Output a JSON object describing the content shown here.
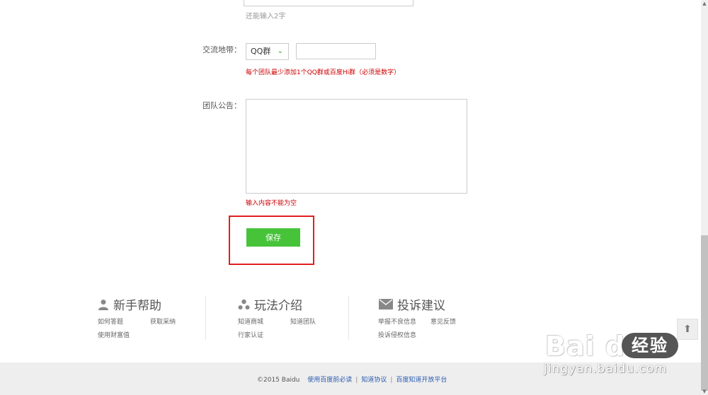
{
  "form": {
    "name_char_hint": "还能输入2字",
    "contact_label": "交流地带：",
    "contact_select_value": "QQ群",
    "contact_input_value": "",
    "contact_error": "每个团队最少添加1个QQ群或百度Hi群（必须是数字）",
    "notice_label": "团队公告：",
    "notice_value": "",
    "notice_error": "输入内容不能为空",
    "save_label": "保存"
  },
  "footer": {
    "columns": [
      {
        "title": "新手帮助",
        "icon": "user-icon",
        "links": [
          "如何答题",
          "获取采纳",
          "使用财富值"
        ]
      },
      {
        "title": "玩法介绍",
        "icon": "molecule-icon",
        "links": [
          "知道商城",
          "知道团队",
          "行家认证"
        ]
      },
      {
        "title": "投诉建议",
        "icon": "mail-icon",
        "links": [
          "举报不良信息",
          "意见反馈",
          "投诉侵权信息"
        ]
      }
    ],
    "copyright": "©2015 Baidu",
    "bottom_links": [
      "使用百度前必读",
      "知道协议",
      "百度知道开放平台"
    ]
  },
  "watermark": {
    "brand": "Bai du",
    "badge": "经验",
    "url": "jingyan.baidu.com"
  },
  "colors": {
    "accent_green": "#47c33a",
    "error_red": "#cc0000",
    "highlight_red": "#e02020",
    "link_blue": "#2a5ab0"
  }
}
